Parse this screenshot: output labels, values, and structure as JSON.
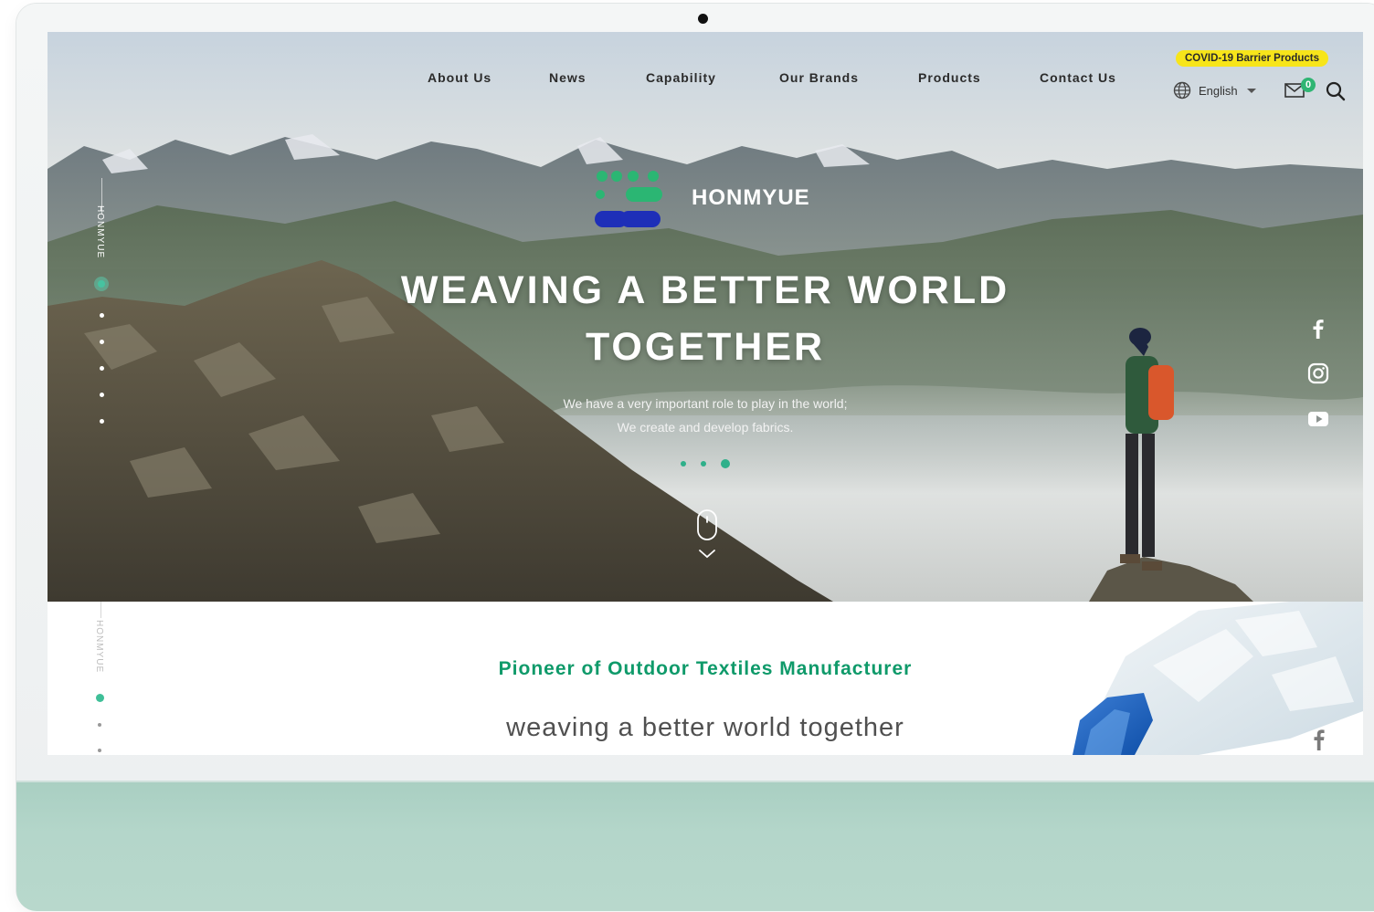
{
  "nav": {
    "items": [
      "About Us",
      "News",
      "Capability",
      "Our Brands",
      "Products",
      "Contact Us"
    ]
  },
  "header": {
    "covid_badge": "COVID-19 Barrier Products",
    "language": "English",
    "mail_count": "0"
  },
  "brand": {
    "name": "HONMYUE",
    "side_label": "HONMYUE"
  },
  "hero": {
    "title_line1": "WEAVING A BETTER WORLD",
    "title_line2": "TOGETHER",
    "subtitle_line1": "We have a very important role to play in the world;",
    "subtitle_line2": "We create and develop fabrics."
  },
  "section": {
    "side_label": "HONMYUE",
    "heading": "Pioneer of Outdoor Textiles Manufacturer",
    "tagline": "weaving a better world together"
  },
  "icons": {
    "social": [
      "facebook-icon",
      "instagram-icon",
      "youtube-icon"
    ]
  },
  "colors": {
    "accent_green": "#0f9a6a",
    "covid_yellow": "#f7e51a",
    "logo_green": "#2bb673",
    "logo_blue": "#1e2fb8",
    "frame_chin": "#b4d6ca"
  }
}
